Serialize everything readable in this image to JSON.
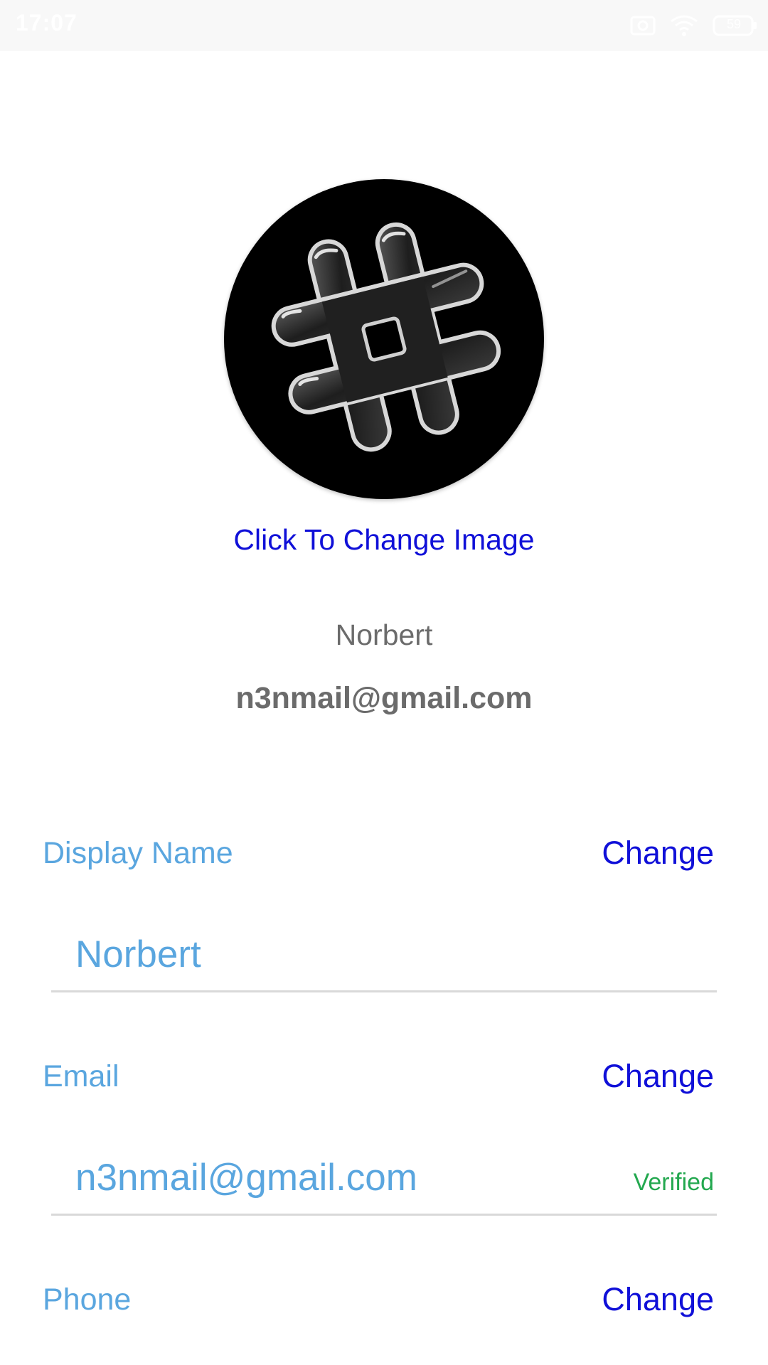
{
  "status_bar": {
    "time": "17:07",
    "battery": "59"
  },
  "profile": {
    "change_image_label": "Click To Change Image",
    "name": "Norbert",
    "email": "n3nmail@gmail.com"
  },
  "fields": {
    "display_name": {
      "label": "Display Name",
      "change_label": "Change",
      "value": "Norbert"
    },
    "email": {
      "label": "Email",
      "change_label": "Change",
      "value": "n3nmail@gmail.com",
      "status": "Verified"
    },
    "phone": {
      "label": "Phone",
      "change_label": "Change"
    }
  },
  "colors": {
    "link": "#1010d8",
    "label": "#5aa6df",
    "verified": "#23a84f",
    "text_gray": "#6b6b6b",
    "divider": "#d9d9d9"
  }
}
